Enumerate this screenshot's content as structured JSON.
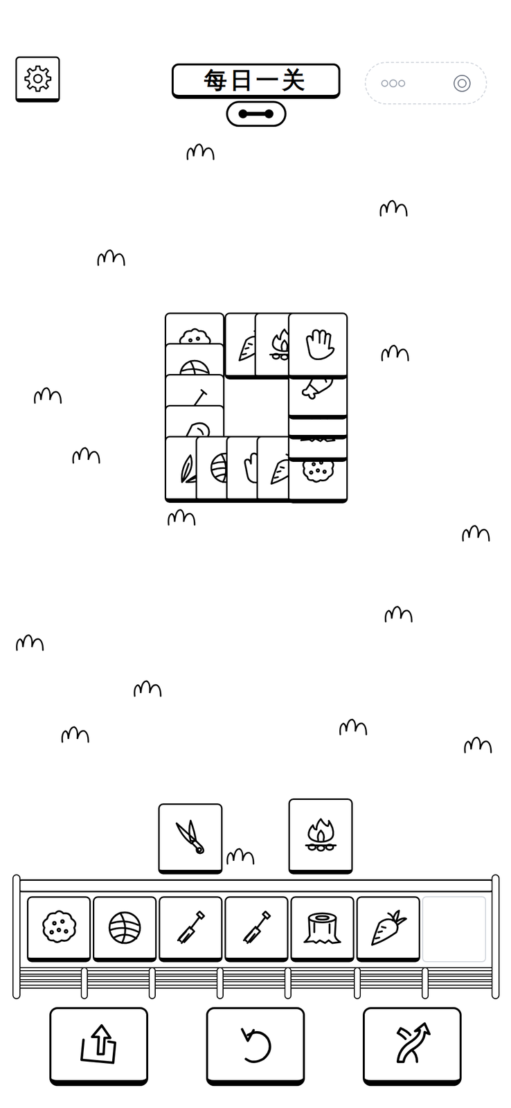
{
  "header": {
    "title": "每日一关"
  },
  "board": {
    "tiles": [
      {
        "kind": "bush"
      },
      {
        "kind": "carrot"
      },
      {
        "kind": "fire"
      },
      {
        "kind": "yarn"
      },
      {
        "kind": "shovel"
      },
      {
        "kind": "meat"
      },
      {
        "kind": "plant"
      },
      {
        "kind": "yarn"
      },
      {
        "kind": "glove"
      },
      {
        "kind": "carrot"
      },
      {
        "kind": "bush"
      },
      {
        "kind": "stump"
      },
      {
        "kind": "stump"
      },
      {
        "kind": "meat"
      },
      {
        "kind": "glove"
      }
    ]
  },
  "pending": [
    {
      "kind": "scissors"
    },
    {
      "kind": "fire"
    }
  ],
  "tray": {
    "slots": [
      {
        "kind": "bush"
      },
      {
        "kind": "yarn"
      },
      {
        "kind": "fork"
      },
      {
        "kind": "fork"
      },
      {
        "kind": "stump"
      },
      {
        "kind": "carrot"
      },
      {
        "kind": "empty"
      }
    ]
  },
  "tools": [
    {
      "kind": "move-out"
    },
    {
      "kind": "undo"
    },
    {
      "kind": "shuffle"
    }
  ]
}
